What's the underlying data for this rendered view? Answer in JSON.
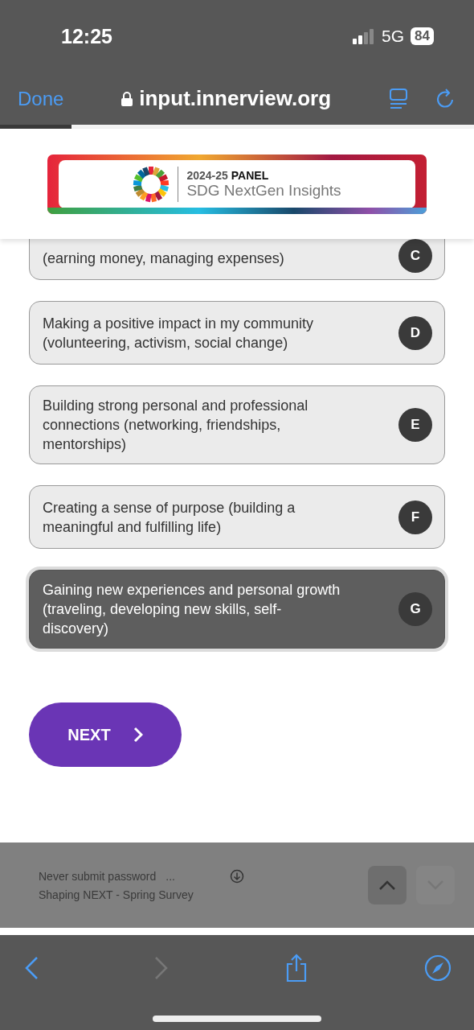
{
  "status_bar": {
    "time": "12:25",
    "network": "5G",
    "battery": "84"
  },
  "browser": {
    "done": "Done",
    "url": "input.innerview.org",
    "progress": {
      "level": 0.15
    }
  },
  "banner": {
    "year": "2024-25",
    "panel": "PANEL",
    "subtitle": "SDG NextGen Insights"
  },
  "options": [
    {
      "letter": "C",
      "text": "(earning money, managing expenses)",
      "selected": false
    },
    {
      "letter": "D",
      "text": "Making a positive impact in my community (volunteering, activism, social change)",
      "selected": false
    },
    {
      "letter": "E",
      "text": "Building strong personal and professional connections (networking, friendships, mentorships)",
      "selected": false
    },
    {
      "letter": "F",
      "text": "Creating a sense of purpose (building a meaningful and fulfilling life)",
      "selected": false
    },
    {
      "letter": "G",
      "text": "Gaining new experiences and personal growth (traveling, developing new skills, self-discovery)",
      "selected": true
    }
  ],
  "next_button": "NEXT",
  "autofill": {
    "line1": "Never submit password",
    "ellipsis": "...",
    "line2": "Shaping NEXT - Spring Survey",
    "up_disabled": false,
    "down_disabled": true
  },
  "toolbar": {
    "back_disabled": false,
    "forward_disabled": true
  }
}
